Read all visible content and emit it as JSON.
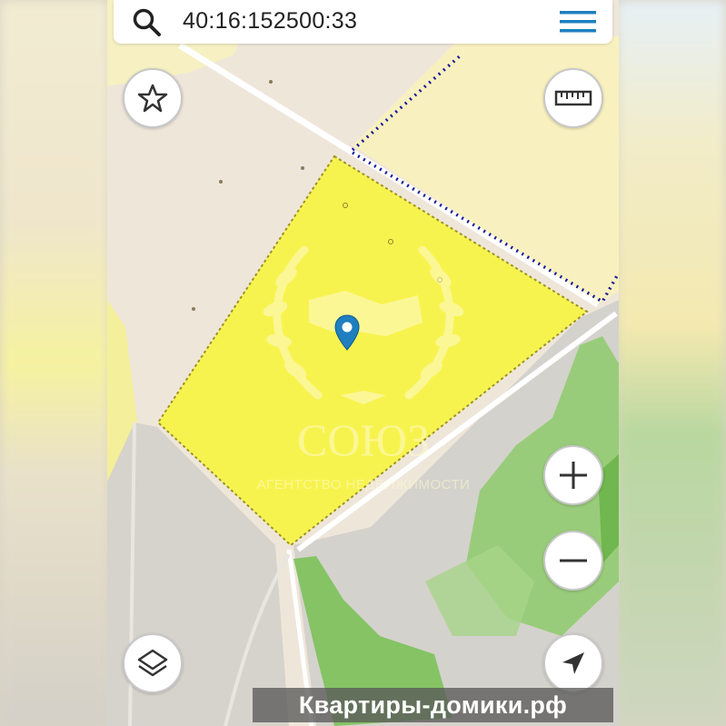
{
  "search": {
    "query": "40:16:152500:33"
  },
  "icons": {
    "search": "search-icon",
    "menu": "hamburger-menu-icon",
    "favorite": "star-icon",
    "ruler": "ruler-icon",
    "zoom_in": "plus-icon",
    "zoom_out": "minus-icon",
    "layers": "layers-icon",
    "locate": "navigation-arrow-icon",
    "marker": "map-pin-icon"
  },
  "watermark": {
    "title": "СОЮЗ",
    "subtitle": "АГЕНТСТВО  НЕДВИЖИМОСТИ"
  },
  "banner": {
    "text": "Квартиры-домики.рф"
  },
  "colors": {
    "parcel_fill": "#f7f34e",
    "parcel_border": "#9a9420",
    "boundary_dots": "#1a1a9a",
    "forest": "#7cc15a",
    "accent_blue": "#1f7fbf"
  }
}
